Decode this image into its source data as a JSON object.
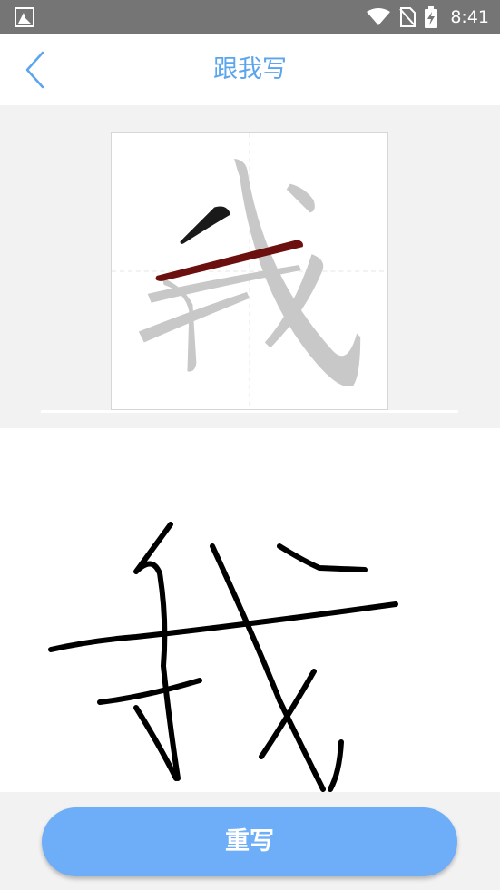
{
  "status_bar": {
    "time": "8:41",
    "icons": [
      "app-notification-icon",
      "wifi-icon",
      "no-sim-icon",
      "battery-charging-icon"
    ]
  },
  "header": {
    "back_icon": "chevron-left-icon",
    "title": "跟我写"
  },
  "practice": {
    "character": "我",
    "active_stroke": 2,
    "highlight_color": "#6b0f0f",
    "guide_color": "#c8c8c8"
  },
  "writing_area": {
    "ink_color": "#000000"
  },
  "actions": {
    "rewrite_label": "重写"
  },
  "colors": {
    "accent": "#5aa5ee",
    "button": "#6eaef8",
    "status_bar": "#757575",
    "panel_bg": "#f2f2f2"
  }
}
